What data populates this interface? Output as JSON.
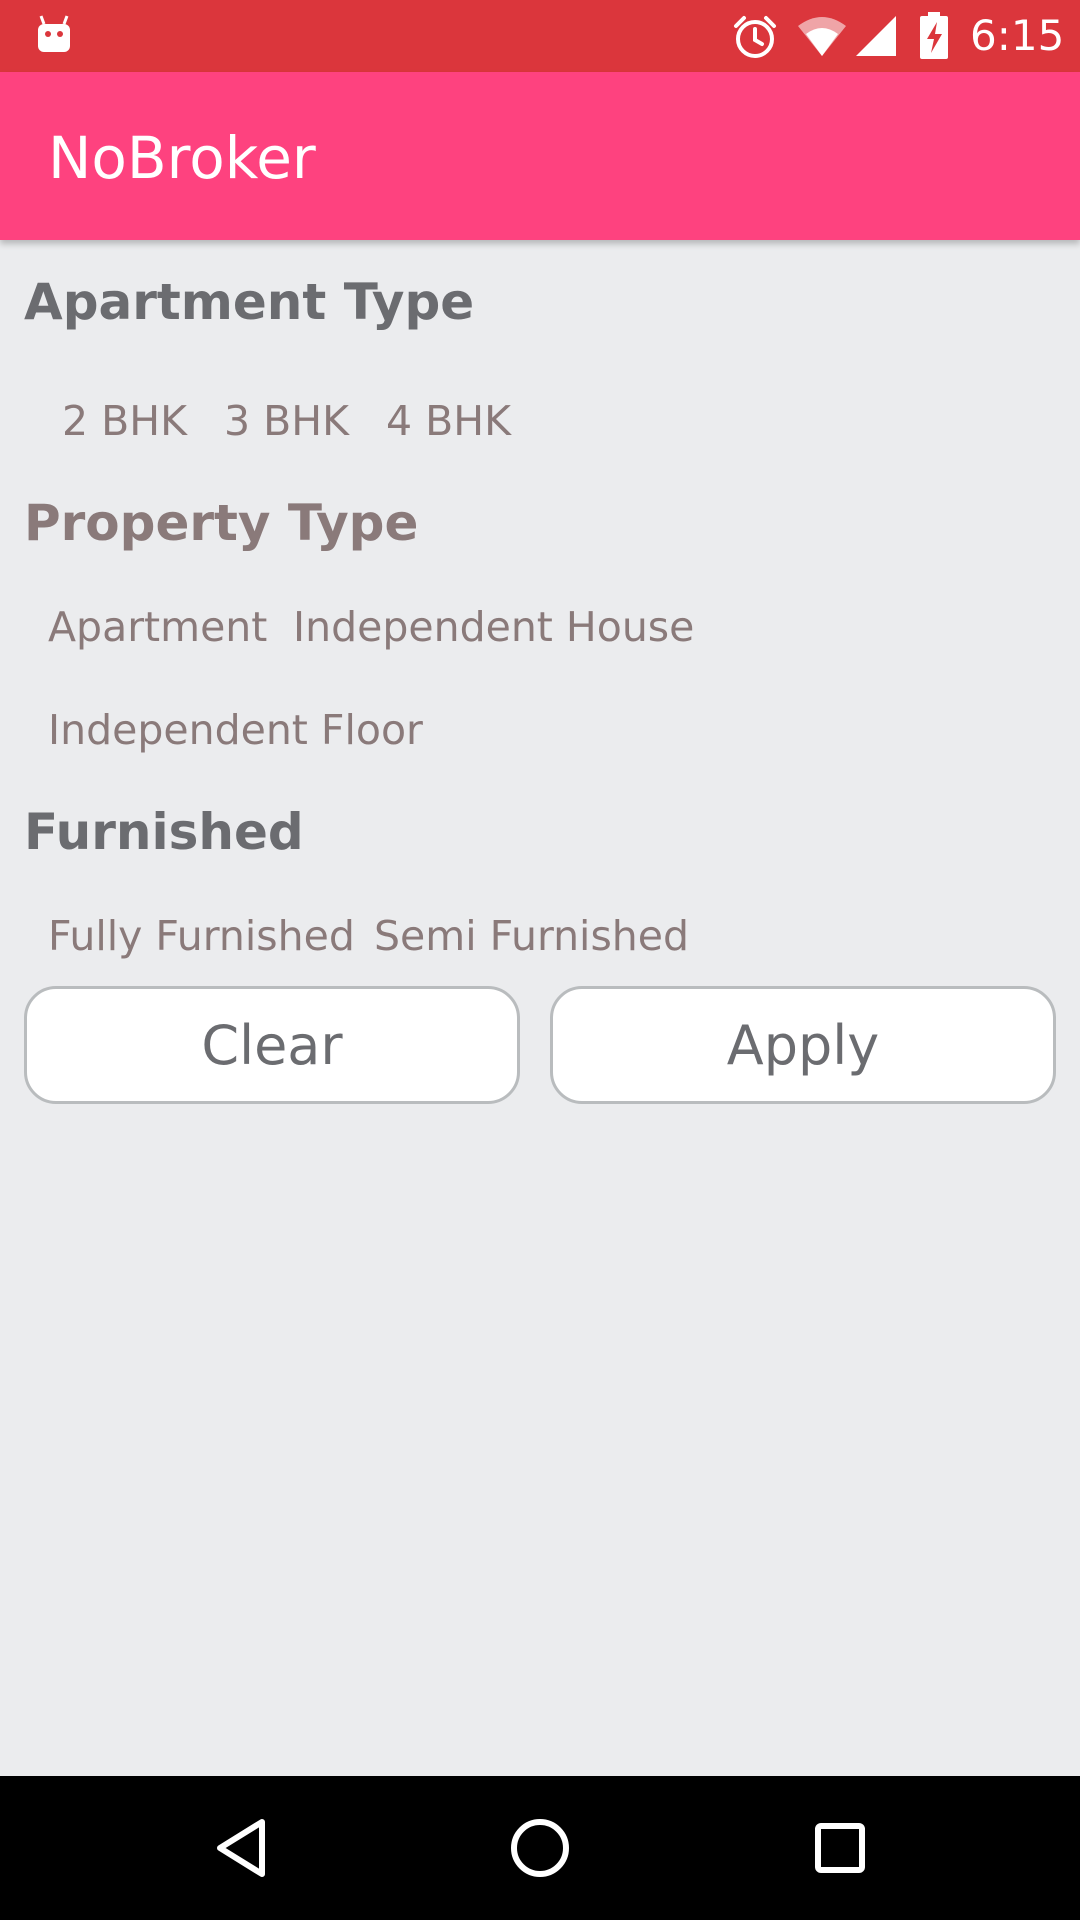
{
  "status_bar": {
    "time": "6:15",
    "icons": [
      "android-debug-icon",
      "alarm-icon",
      "wifi-icon",
      "signal-icon",
      "battery-charging-icon"
    ]
  },
  "app_bar": {
    "title": "NoBroker",
    "background_color": "#fe427f"
  },
  "filters": {
    "apartment_type": {
      "title": "Apartment Type",
      "options": [
        "2 BHK",
        "3 BHK",
        "4 BHK"
      ]
    },
    "property_type": {
      "title": "Property Type",
      "options": [
        "Apartment",
        "Independent House",
        "Independent Floor"
      ]
    },
    "furnished": {
      "title": "Furnished",
      "options": [
        "Fully Furnished",
        "Semi Furnished"
      ]
    }
  },
  "actions": {
    "clear_label": "Clear",
    "apply_label": "Apply"
  },
  "nav_bar": {
    "buttons": [
      "back-icon",
      "home-icon",
      "recents-icon"
    ]
  },
  "colors": {
    "status_bar": "#db363c",
    "background": "#ebecee",
    "section_title": "#6b6c70",
    "option_text": "#8a7a7a"
  }
}
